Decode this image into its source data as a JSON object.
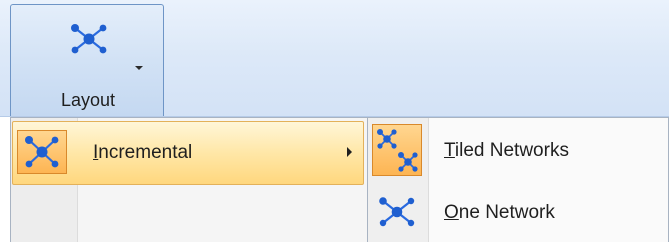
{
  "ribbon": {
    "layout_button": {
      "label": "Layout",
      "icon": "network-layout-icon"
    }
  },
  "menu": {
    "items": [
      {
        "label_accel": "I",
        "label_rest": "ncremental",
        "icon": "network-layout-icon",
        "has_submenu": true,
        "highlighted": true
      }
    ]
  },
  "submenu": {
    "items": [
      {
        "label_accel": "T",
        "label_rest": "iled Networks",
        "icon": "tiled-networks-icon",
        "checked": true
      },
      {
        "label_accel": "O",
        "label_rest": "ne Network",
        "icon": "one-network-icon",
        "checked": false
      }
    ]
  },
  "colors": {
    "node_blue": "#1f5fd0",
    "edge_blue": "#2a6adf",
    "highlight_fill": "#ffe7a7",
    "highlight_border": "#e3b15a",
    "checked_icon_bg": "#fdb553"
  }
}
